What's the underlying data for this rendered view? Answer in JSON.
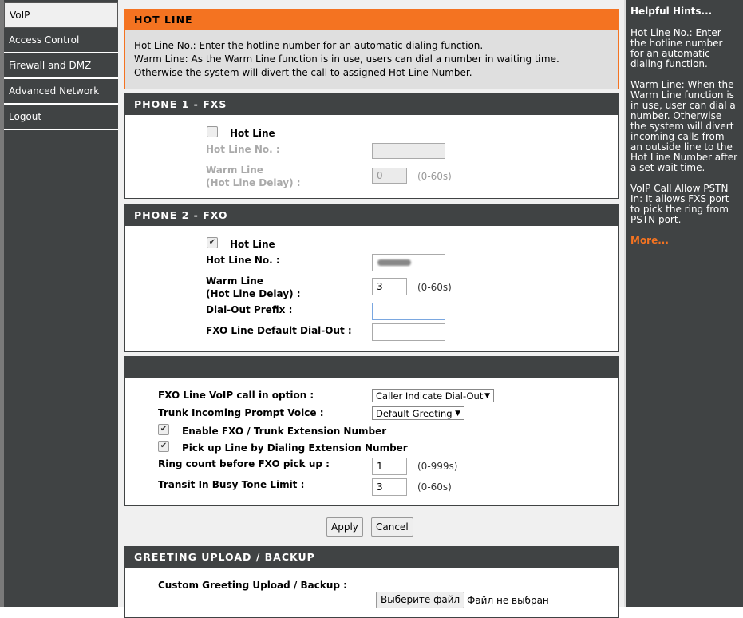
{
  "sidebar": {
    "items": [
      {
        "label": "VoIP"
      },
      {
        "label": "Access Control"
      },
      {
        "label": "Firewall and DMZ"
      },
      {
        "label": "Advanced Network"
      },
      {
        "label": "Logout"
      }
    ]
  },
  "hotline": {
    "title": "HOT LINE",
    "desc1": "Hot Line No.: Enter the hotline number for an automatic dialing function.",
    "desc2": "Warm Line: As the Warm Line function is in use, users can dial a number in waiting time. Otherwise the system will divert the call to assigned Hot Line Number."
  },
  "phone1": {
    "title": "PHONE 1 - FXS",
    "hotline_label": "Hot Line",
    "hotline_checked": false,
    "number_label": "Hot Line No. :",
    "number_value": "",
    "warm_label1": "Warm Line",
    "warm_label2": "(Hot Line Delay) :",
    "warm_value": "0",
    "warm_range": "(0-60s)"
  },
  "phone2": {
    "title": "PHONE 2 - FXO",
    "hotline_label": "Hot Line",
    "hotline_checked": true,
    "number_label": "Hot Line No. :",
    "warm_label1": "Warm Line",
    "warm_label2": "(Hot Line Delay) :",
    "warm_value": "3",
    "warm_range": "(0-60s)",
    "prefix_label": "Dial-Out Prefix :",
    "prefix_value": "",
    "default_label": "FXO Line Default Dial-Out :",
    "default_value": ""
  },
  "fxo": {
    "voip_label": "FXO Line VoIP call in option :",
    "voip_value": "Caller Indicate Dial-Out",
    "prompt_label": "Trunk Incoming Prompt Voice :",
    "prompt_value": "Default Greeting",
    "ext_label": "Enable FXO / Trunk Extension Number",
    "pickup_label": "Pick up Line by Dialing Extension Number",
    "ring_label": "Ring count before FXO pick up :",
    "ring_value": "1",
    "ring_range": "(0-999s)",
    "busy_label": "Transit In Busy Tone Limit :",
    "busy_value": "3",
    "busy_range": "(0-60s)"
  },
  "buttons": {
    "apply": "Apply",
    "cancel": "Cancel"
  },
  "greeting": {
    "title": "GREETING UPLOAD / BACKUP",
    "label": "Custom Greeting Upload / Backup :",
    "file_button": "Выберите файл",
    "file_status": "Файл не выбран"
  },
  "hints": {
    "title": "Helpful Hints...",
    "p1": "Hot Line No.: Enter the hotline number for an automatic dialing function.",
    "p2": "Warm Line: When the Warm Line function is in use, user can dial a number. Otherwise the system will divert incoming calls from an outside line to the Hot Line Number after a set wait time.",
    "p3": "VoIP Call Allow PSTN In: It allows FXS port to pick the ring from PSTN port.",
    "more": "More..."
  }
}
